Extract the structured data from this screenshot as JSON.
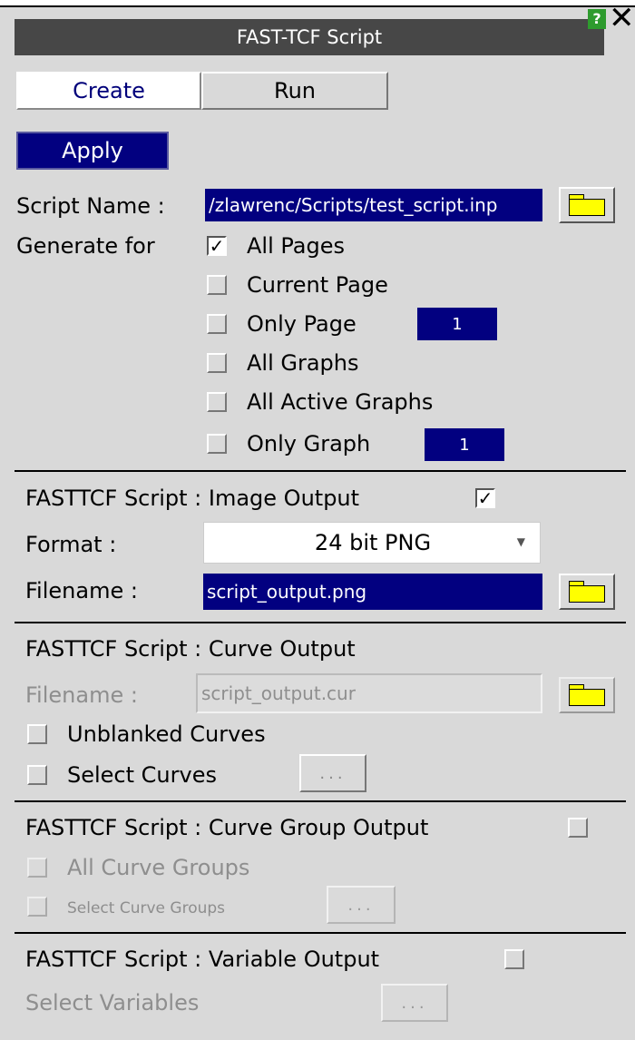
{
  "window": {
    "title": "FAST-TCF Script",
    "help_label": "?",
    "close_label": "✕"
  },
  "tabs": [
    {
      "label": "Create",
      "active": true
    },
    {
      "label": "Run",
      "active": false
    }
  ],
  "apply_label": "Apply",
  "script_name": {
    "label": "Script Name :",
    "value": "/zlawrenc/Scripts/test_script.inp"
  },
  "generate_for": {
    "label": "Generate for",
    "options": [
      {
        "label": "All Pages",
        "checked": "✓"
      },
      {
        "label": "Current Page",
        "checked": ""
      },
      {
        "label": "Only Page",
        "checked": "",
        "value": "1"
      },
      {
        "label": "All Graphs",
        "checked": ""
      },
      {
        "label": "All Active Graphs",
        "checked": ""
      },
      {
        "label": "Only Graph",
        "checked": "",
        "value": "1"
      }
    ]
  },
  "image_output": {
    "heading": "FASTTCF Script : Image Output",
    "enabled_mark": "✓",
    "format_label": "Format :",
    "format_value": "24 bit PNG",
    "filename_label": "Filename :",
    "filename_value": "script_output.png"
  },
  "curve_output": {
    "heading": "FASTTCF Script : Curve Output",
    "filename_label": "Filename :",
    "filename_value": "script_output.cur",
    "unblanked_label": "Unblanked Curves",
    "select_label": "Select Curves",
    "select_button": "..."
  },
  "curve_group_output": {
    "heading": "FASTTCF Script : Curve Group Output",
    "all_label": "All Curve Groups",
    "select_label": "Select Curve Groups",
    "select_button": "..."
  },
  "variable_output": {
    "heading": "FASTTCF Script : Variable Output",
    "select_label": "Select Variables",
    "select_button": "..."
  },
  "colors": {
    "accent_blue": "#020080",
    "folder_yellow": "#ffff00",
    "panel_grey": "#d9d9d9",
    "title_bar": "#474747",
    "help_green": "#2e9b2e"
  }
}
